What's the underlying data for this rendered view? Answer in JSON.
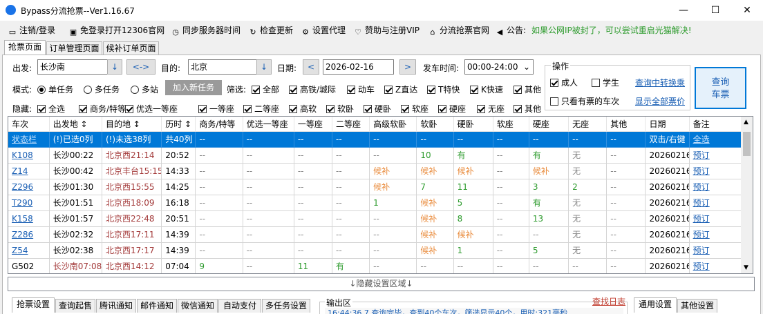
{
  "window": {
    "title": "Bypass分流抢票--Ver1.16.67",
    "minimize": "—",
    "maximize": "☐",
    "close": "✕"
  },
  "menu": [
    {
      "icon": "monitor-icon",
      "glyph": "▭",
      "label": "注销/登录"
    },
    {
      "icon": "window-icon",
      "glyph": "▣",
      "label": "免登录打开12306官网"
    },
    {
      "icon": "clock-icon",
      "glyph": "◷",
      "label": "同步服务器时间"
    },
    {
      "icon": "refresh-icon",
      "glyph": "↻",
      "label": "检查更新"
    },
    {
      "icon": "gear-icon",
      "glyph": "⚙",
      "label": "设置代理"
    },
    {
      "icon": "heart-icon",
      "glyph": "♡",
      "label": "赞助与注册VIP"
    },
    {
      "icon": "home-icon",
      "glyph": "⌂",
      "label": "分流抢票官网"
    },
    {
      "icon": "speaker-icon",
      "glyph": "◀",
      "label": "公告:"
    }
  ],
  "announcement": "如果公网IP被封了，可以尝试重启光猫解决!",
  "tabs": [
    "抢票页面",
    "订单管理页面",
    "候补订单页面"
  ],
  "search": {
    "from_label": "出发:",
    "from_value": "长沙南",
    "swap": "<->",
    "to_label": "目的:",
    "to_value": "北京",
    "date_label": "日期:",
    "date_value": "2026-02-16",
    "prev": "<",
    "next": ">",
    "time_label": "发车时间:",
    "time_value": "00:00-24:00",
    "mode_label": "模式:",
    "modes": [
      "单任务",
      "多任务",
      "多站"
    ],
    "add_task": "加入新任务",
    "filter_label": "筛选:",
    "filters": [
      "全部",
      "高铁/城际",
      "动车",
      "Z直达",
      "T特快",
      "K快速",
      "其他"
    ],
    "hide_label": "隐藏:",
    "hides": [
      "全选",
      "商务/特等",
      "优选一等座",
      "一等座",
      "二等座",
      "高软",
      "软卧",
      "硬卧",
      "软座",
      "硬座",
      "无座",
      "其他"
    ]
  },
  "ops": {
    "title": "操作",
    "adult": "成人",
    "student": "学生",
    "only_tickets": "只看有票的车次",
    "transfer": "查询中转换乘",
    "show_prices": "显示全部票价",
    "query_btn": "查询\n车票"
  },
  "grid": {
    "headers": [
      "车次",
      "出发地 ↕",
      "目的地 ↕",
      "历时 ↕",
      "商务/特等",
      "优选一等座",
      "一等座",
      "二等座",
      "高级软卧",
      "软卧",
      "硬卧",
      "软座",
      "硬座",
      "无座",
      "其他",
      "日期",
      "备注"
    ],
    "status_row": [
      "状态栏",
      "(!)已选0列",
      "(!)未选38列",
      "共40列",
      "--",
      "--",
      "--",
      "--",
      "--",
      "--",
      "--",
      "--",
      "--",
      "--",
      "--",
      "双击/右键",
      "全选"
    ],
    "rows": [
      [
        "K108",
        "长沙00:22",
        "北京西21:14",
        "20:52",
        "--",
        "--",
        "--",
        "--",
        "--",
        "10",
        "有",
        "--",
        "有",
        "无",
        "--",
        "20260216",
        "预订"
      ],
      [
        "Z14",
        "长沙00:42",
        "北京丰台15:15",
        "14:33",
        "--",
        "--",
        "--",
        "--",
        "候补",
        "候补",
        "候补",
        "--",
        "候补",
        "无",
        "--",
        "20260216",
        "预订"
      ],
      [
        "Z296",
        "长沙01:30",
        "北京西15:55",
        "14:25",
        "--",
        "--",
        "--",
        "--",
        "候补",
        "7",
        "11",
        "--",
        "3",
        "2",
        "--",
        "20260216",
        "预订"
      ],
      [
        "T290",
        "长沙01:51",
        "北京西18:09",
        "16:18",
        "--",
        "--",
        "--",
        "--",
        "1",
        "候补",
        "5",
        "--",
        "有",
        "无",
        "--",
        "20260216",
        "预订"
      ],
      [
        "K158",
        "长沙01:57",
        "北京西22:48",
        "20:51",
        "--",
        "--",
        "--",
        "--",
        "--",
        "候补",
        "8",
        "--",
        "13",
        "无",
        "--",
        "20260216",
        "预订"
      ],
      [
        "Z286",
        "长沙02:32",
        "北京西17:11",
        "14:39",
        "--",
        "--",
        "--",
        "--",
        "--",
        "候补",
        "候补",
        "--",
        "--",
        "无",
        "--",
        "20260216",
        "预订"
      ],
      [
        "Z54",
        "长沙02:38",
        "北京西17:17",
        "14:39",
        "--",
        "--",
        "--",
        "--",
        "--",
        "候补",
        "1",
        "--",
        "5",
        "无",
        "--",
        "20260216",
        "预订"
      ],
      [
        "G502",
        "长沙南07:08",
        "北京西14:12",
        "07:04",
        "9",
        "--",
        "11",
        "有",
        "--",
        "--",
        "--",
        "--",
        "--",
        "--",
        "--",
        "20260216",
        "预订"
      ]
    ]
  },
  "hidden_area": "↓隐藏设置区域↓",
  "bottom_tabs": [
    "抢票设置",
    "查询起售",
    "腾讯通知",
    "邮件通知",
    "微信通知",
    "自动支付",
    "多任务设置"
  ],
  "output": {
    "label": "输出区",
    "find_log": "查找日志",
    "line": "16:44:36.7 查询完毕，查到40个车次，筛选显示40个，用时:321毫秒"
  },
  "right_tabs": [
    "通用设置",
    "其他设置"
  ],
  "colors": {
    "accent": "#0078d7",
    "link": "#1a5fb4",
    "red": "#a33a3a",
    "green": "#2e9b2e",
    "orange": "#e98a3a"
  }
}
